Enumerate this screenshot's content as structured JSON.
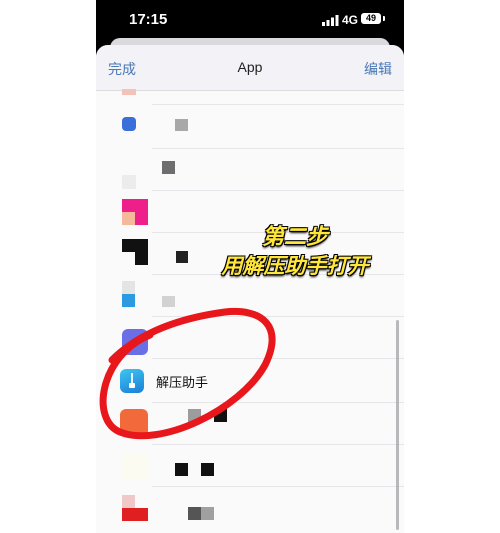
{
  "status_bar": {
    "time": "17:15",
    "network": "4G",
    "battery": "49"
  },
  "nav": {
    "done_label": "完成",
    "title": "App",
    "edit_label": "编辑"
  },
  "highlighted_app": {
    "name": "解压助手",
    "icon": "zipper-app-icon"
  },
  "overlay": {
    "line1": "第二步",
    "line2": "用解压助手打开",
    "color": "#ffe63a"
  },
  "annotation": {
    "shape": "hand-drawn-circle",
    "color": "#e8171b"
  }
}
